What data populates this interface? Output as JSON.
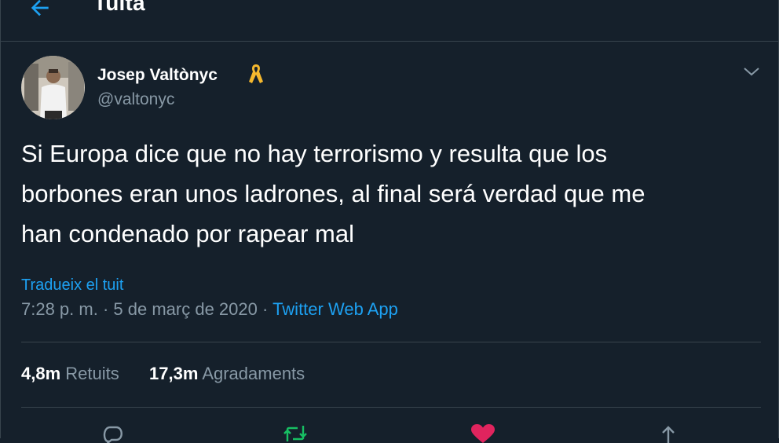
{
  "header": {
    "title": "Tuita"
  },
  "tweet": {
    "author_name": "Josep Valtònyc",
    "author_handle": "@valtonyc",
    "text_lines": [
      "Si Europa dice que no hay terrorismo y resulta que los",
      "borbones eran unos ladrones, al final será verdad que me",
      "han condenado por rapear mal"
    ],
    "translate_label": "Tradueix el tuit",
    "time": "7:28 p. m.",
    "separator": "·",
    "date": "5 de març de 2020",
    "source": "Twitter Web App"
  },
  "stats": {
    "retweets_count": "4,8m",
    "retweets_label": "Retuits",
    "likes_count": "17,3m",
    "likes_label": "Agradaments"
  },
  "colors": {
    "background": "#15202b",
    "accent": "#1da1f2",
    "secondary_text": "#8899a6",
    "border": "#38444d",
    "ribbon": "#f5b82e",
    "retweet": "#17bf63",
    "like": "#e0245e"
  },
  "icons": {
    "back": "back-arrow-icon",
    "ribbon": "yellow-ribbon-icon",
    "more": "chevron-down-icon",
    "reply": "reply-icon",
    "retweet": "retweet-icon",
    "like": "heart-icon",
    "share": "share-icon"
  }
}
